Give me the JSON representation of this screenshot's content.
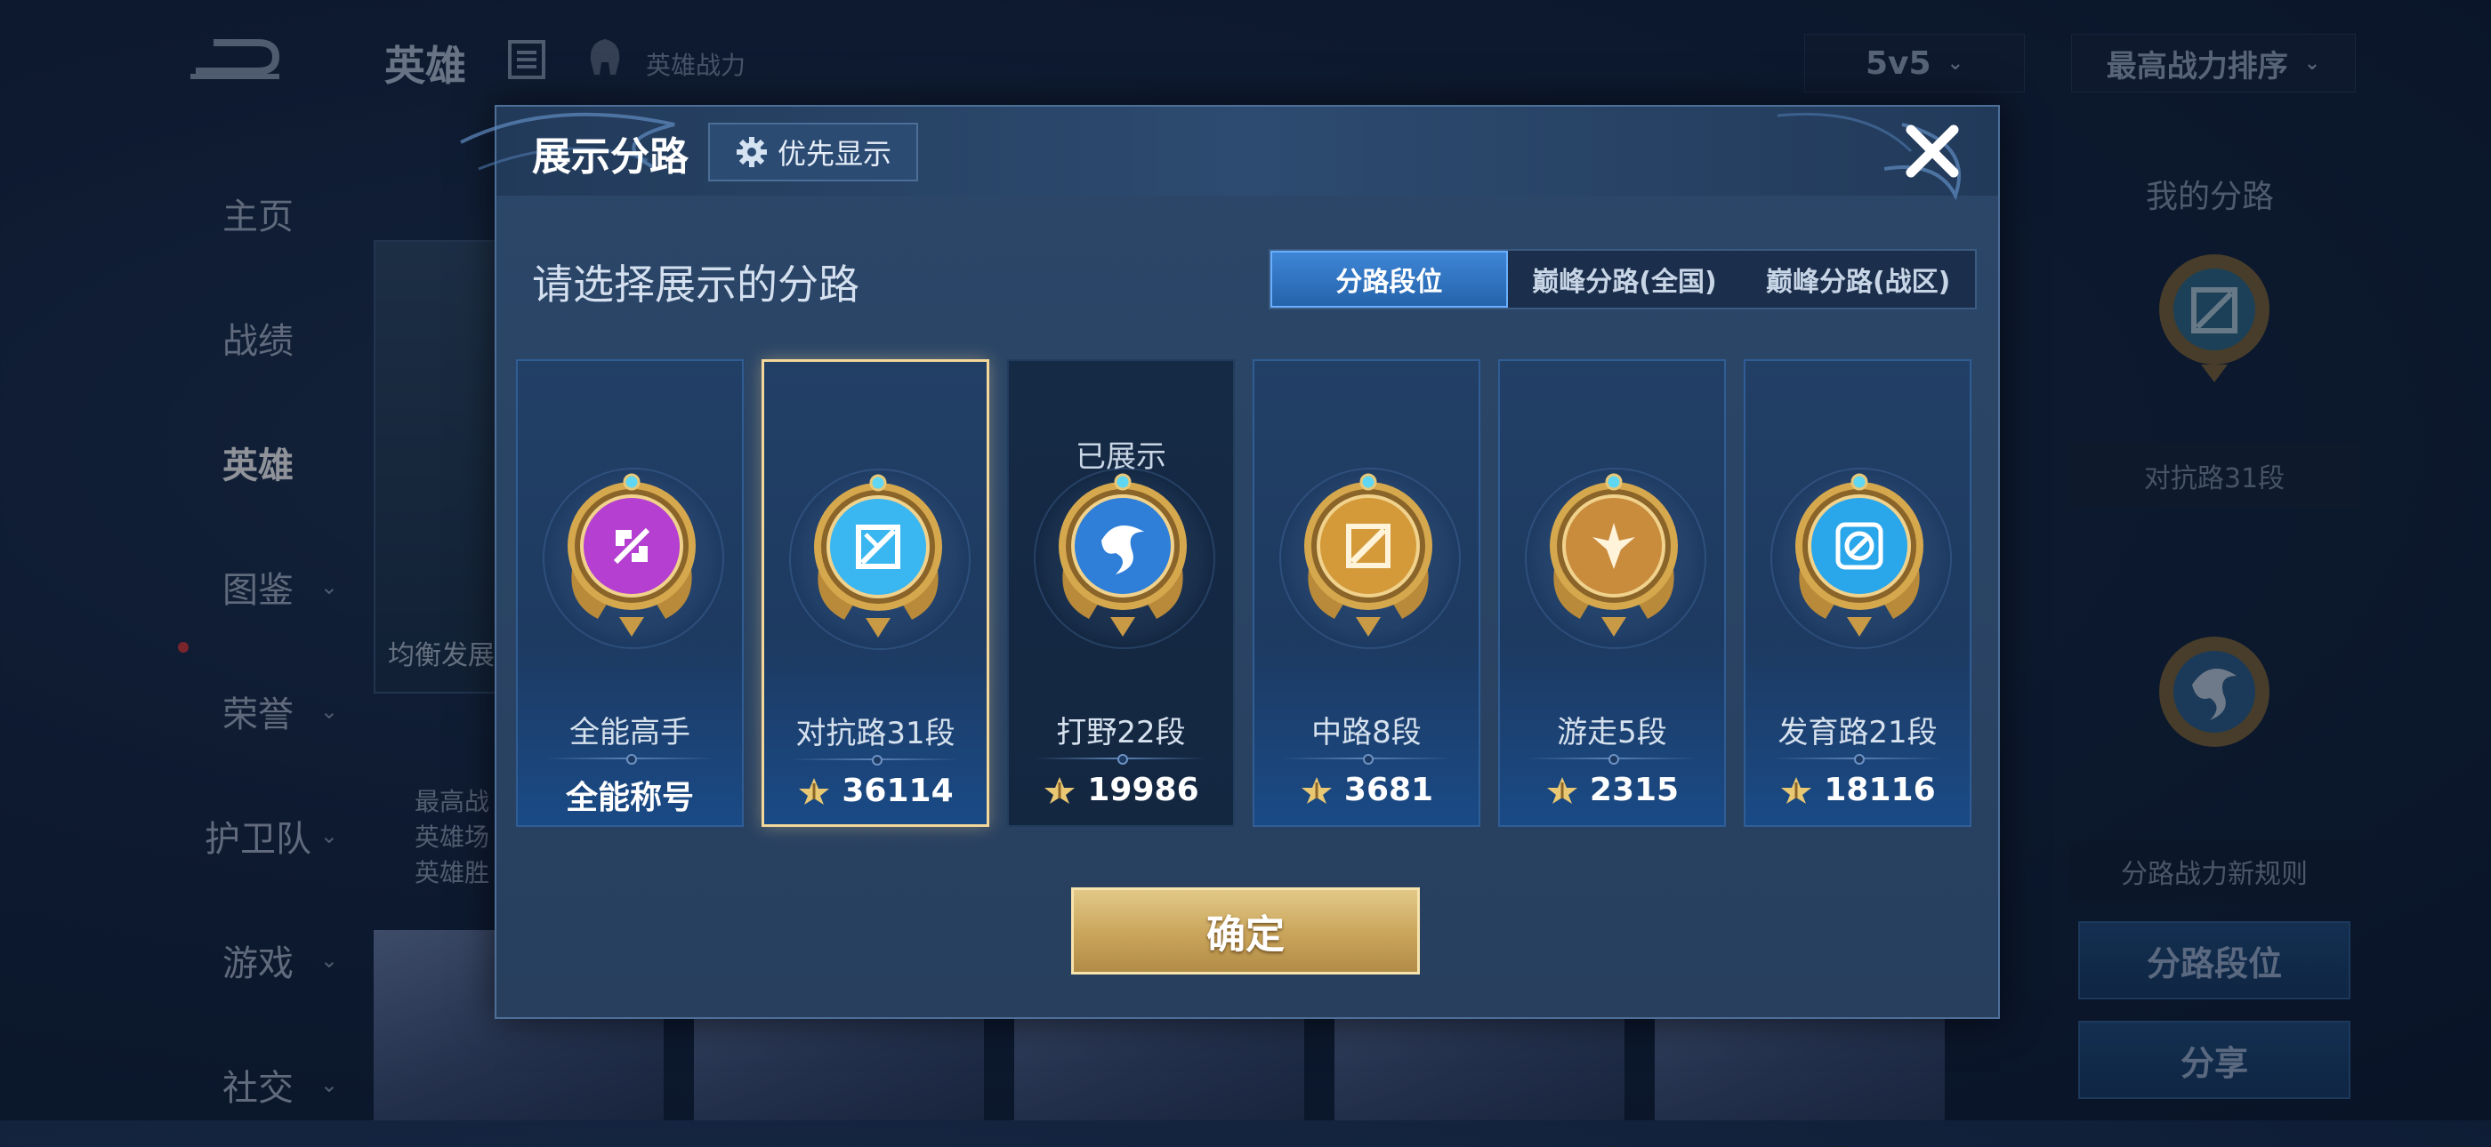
{
  "background": {
    "title": "英雄",
    "subtitle": "英雄战力",
    "mode_select": "5v5",
    "sort_select": "最高战力排序",
    "nav": [
      {
        "label": "主页",
        "active": false,
        "chevron": false
      },
      {
        "label": "战绩",
        "active": false,
        "chevron": false
      },
      {
        "label": "英雄",
        "active": true,
        "chevron": false
      },
      {
        "label": "图鉴",
        "active": false,
        "chevron": true
      },
      {
        "label": "荣誉",
        "active": false,
        "chevron": true
      },
      {
        "label": "护卫队",
        "active": false,
        "chevron": true
      },
      {
        "label": "游戏",
        "active": false,
        "chevron": true
      },
      {
        "label": "社交",
        "active": false,
        "chevron": true
      }
    ],
    "hero_tag": "均衡发展",
    "hero_stats": [
      "最高战",
      "英雄场",
      "英雄胜"
    ],
    "right_panel": {
      "title": "我的分路",
      "lane_label": "对抗路31段",
      "rule_link": "分路战力新规则",
      "lane_button": "分路段位",
      "share_button": "分享"
    }
  },
  "modal": {
    "title": "展示分路",
    "priority_button": "优先显示",
    "subtitle": "请选择展示的分路",
    "tabs": [
      {
        "label": "分路段位",
        "active": true
      },
      {
        "label": "巅峰分路(全国)",
        "active": false
      },
      {
        "label": "巅峰分路(战区)",
        "active": false
      }
    ],
    "cards": [
      {
        "name": "全能高手",
        "value": "全能称号",
        "icon": "all-round-badge-icon",
        "selected": false,
        "shown_label": "",
        "show_power_icon": false,
        "color": "#b43fd0"
      },
      {
        "name": "对抗路31段",
        "value": "36114",
        "icon": "clash-lane-badge-icon",
        "selected": true,
        "shown_label": "",
        "show_power_icon": true,
        "color": "#3ab6f0"
      },
      {
        "name": "打野22段",
        "value": "19986",
        "icon": "jungle-badge-icon",
        "selected": false,
        "shown_label": "已展示",
        "show_power_icon": true,
        "color": "#2f7fd8"
      },
      {
        "name": "中路8段",
        "value": "3681",
        "icon": "mid-lane-badge-icon",
        "selected": false,
        "shown_label": "",
        "show_power_icon": true,
        "color": "#d49a3a"
      },
      {
        "name": "游走5段",
        "value": "2315",
        "icon": "roam-badge-icon",
        "selected": false,
        "shown_label": "",
        "show_power_icon": true,
        "color": "#c98b3c"
      },
      {
        "name": "发育路21段",
        "value": "18116",
        "icon": "farm-lane-badge-icon",
        "selected": false,
        "shown_label": "",
        "show_power_icon": true,
        "color": "#2aa6ea"
      }
    ],
    "confirm_button": "确定"
  }
}
